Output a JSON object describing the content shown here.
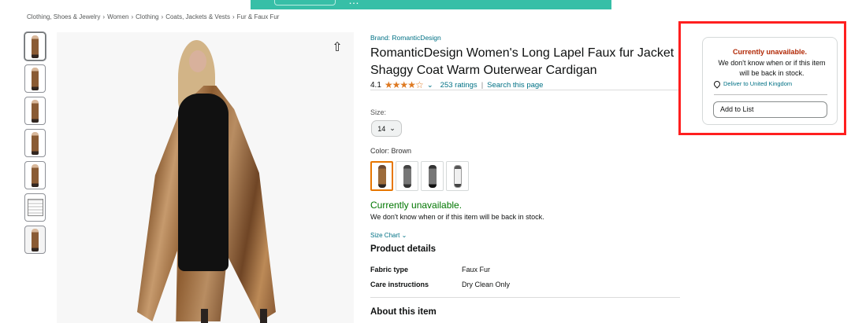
{
  "banner": {
    "text": "…"
  },
  "breadcrumb": [
    "Clothing, Shoes & Jewelry",
    "Women",
    "Clothing",
    "Coats, Jackets & Vests",
    "Fur & Faux Fur"
  ],
  "breadcrumb_sep": "›",
  "product": {
    "brand": "Brand: RomanticDesign",
    "title": "RomanticDesign Women's Long Lapel Faux fur Jacket Shaggy Coat Warm Outerwear Cardigan",
    "rating_value": "4.1",
    "rating_stars": "★★★★☆",
    "rating_chevron": "⌄",
    "ratings_count": "253 ratings",
    "rating_sep": "|",
    "search_page": "Search this page"
  },
  "options": {
    "size_label": "Size:",
    "size_value": "14",
    "size_chevron": "⌄",
    "color_label": "Color: Brown",
    "swatches": [
      "Brown",
      "Gray",
      "Black",
      "White"
    ]
  },
  "availability": {
    "status": "Currently unavailable.",
    "message": "We don't know when or if this item will be back in stock.",
    "size_chart": "Size Chart ⌄"
  },
  "details": {
    "heading": "Product details",
    "rows": [
      {
        "label": "Fabric type",
        "value": "Faux Fur"
      },
      {
        "label": "Care instructions",
        "value": "Dry Clean Only"
      }
    ],
    "about": "About this item"
  },
  "buybox": {
    "status": "Currently unavailable.",
    "message": "We don't know when or if this item will be back in stock.",
    "deliver": "Deliver to United Kingdom",
    "add_to_list": "Add to List"
  },
  "share_icon": "⇧",
  "colors": {
    "accent": "#007185",
    "star": "#de7921",
    "green": "#007600",
    "red": "#b12704",
    "highlight": "#ff1f1f",
    "banner": "#37bfa7"
  }
}
